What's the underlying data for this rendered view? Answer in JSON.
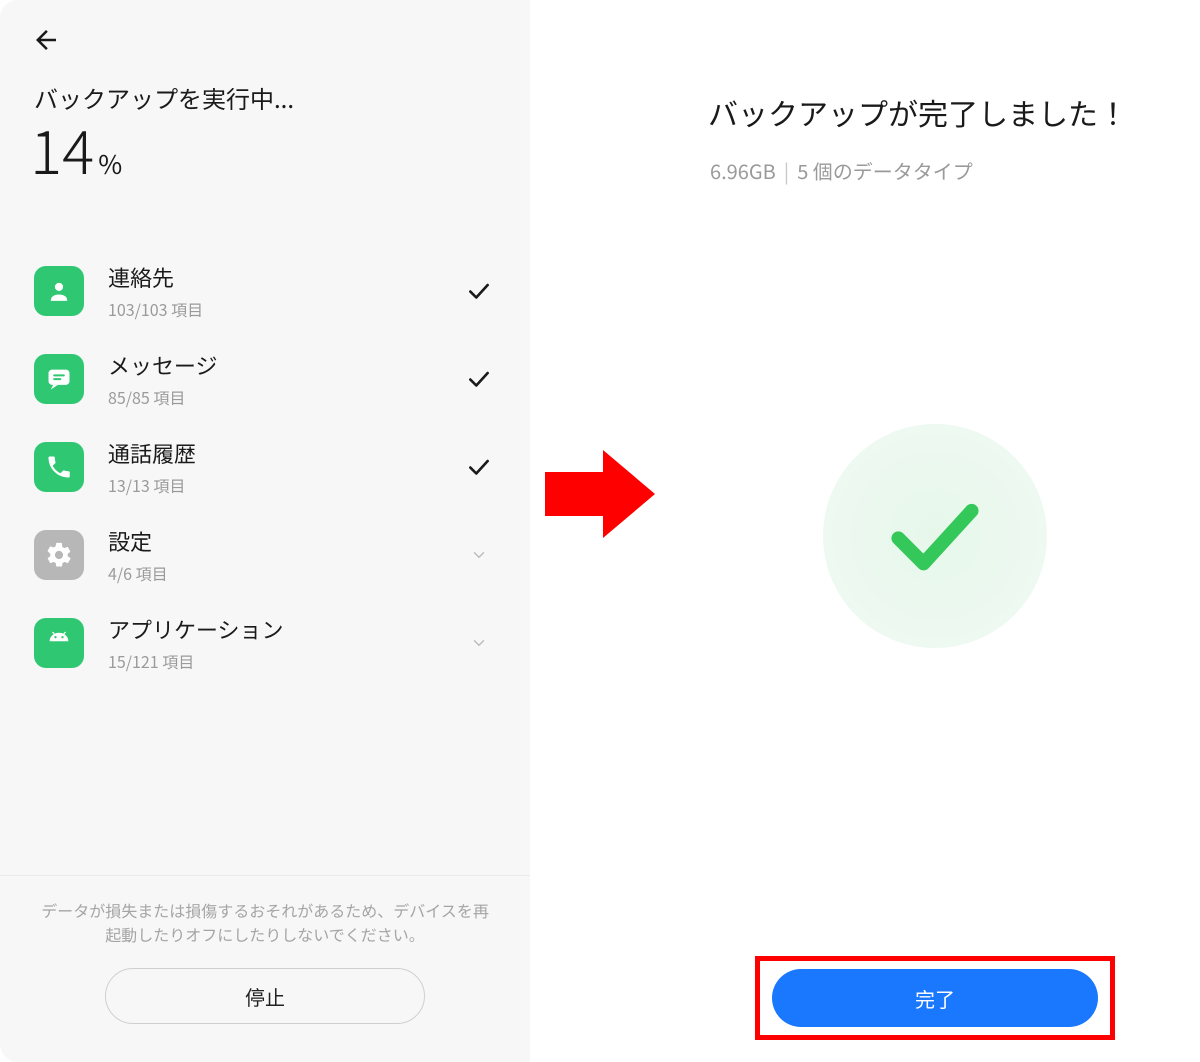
{
  "left": {
    "title": "バックアップを実行中...",
    "percent": "14",
    "percent_unit": "%",
    "items": [
      {
        "icon": "contact",
        "title": "連絡先",
        "sub": "103/103 項目",
        "status": "done"
      },
      {
        "icon": "message",
        "title": "メッセージ",
        "sub": "85/85 項目",
        "status": "done"
      },
      {
        "icon": "phone",
        "title": "通話履歴",
        "sub": "13/13 項目",
        "status": "done"
      },
      {
        "icon": "gear",
        "title": "設定",
        "sub": "4/6 項目",
        "status": "pending"
      },
      {
        "icon": "android",
        "title": "アプリケーション",
        "sub": "15/121 項目",
        "status": "pending"
      }
    ],
    "warning": "データが損失または損傷するおそれがあるため、デバイスを再起動したりオフにしたりしないでください。",
    "stop_label": "停止"
  },
  "right": {
    "title": "バックアップが完了しました！",
    "size": "6.96GB",
    "types": "5 個のデータタイプ",
    "done_label": "完了"
  }
}
